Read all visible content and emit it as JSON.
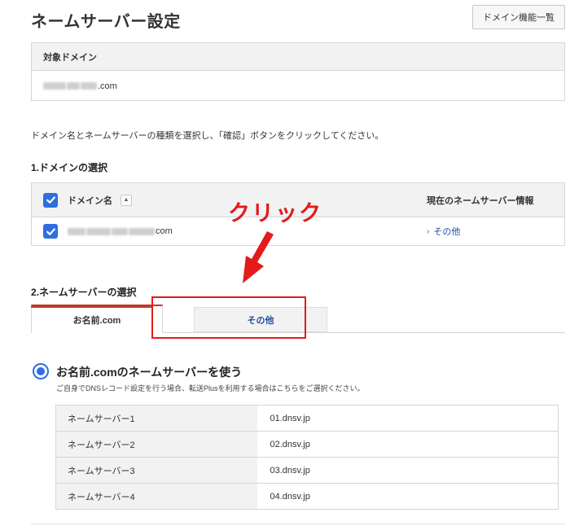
{
  "header": {
    "title": "ネームサーバー設定",
    "domain_list_button": "ドメイン機能一覧"
  },
  "target": {
    "heading": "対象ドメイン",
    "domain_suffix": ".com"
  },
  "instruction": "ドメイン名とネームサーバーの種類を選択し、「確認」ボタンをクリックしてください。",
  "domain_section": {
    "title": "1.ドメインの選択",
    "col_domain": "ドメイン名",
    "sort_icon": "▲",
    "col_nameserver": "現在のネームサーバー情報",
    "row": {
      "domain_suffix": "com",
      "nameserver_link": "その他",
      "checked": true
    }
  },
  "annotation": {
    "text": "クリック",
    "color": "#e31b1b"
  },
  "nameserver_section": {
    "title": "2.ネームサーバーの選択",
    "tabs": [
      {
        "label": "お名前.com",
        "active": true
      },
      {
        "label": "その他",
        "active": false
      }
    ],
    "option_label": "お名前.comのネームサーバーを使う",
    "option_note": "ご自身でDNSレコード設定を行う場合、転送Plusを利用する場合はこちらをご選択ください。",
    "servers": [
      {
        "label": "ネームサーバー1",
        "value": "01.dnsv.jp"
      },
      {
        "label": "ネームサーバー2",
        "value": "02.dnsv.jp"
      },
      {
        "label": "ネームサーバー3",
        "value": "03.dnsv.jp"
      },
      {
        "label": "ネームサーバー4",
        "value": "04.dnsv.jp"
      }
    ]
  },
  "colors": {
    "accent": "#2d6fe0",
    "link": "#1d4fa0",
    "tab_indicator": "#c0392b",
    "annotation": "#e31b1b"
  }
}
